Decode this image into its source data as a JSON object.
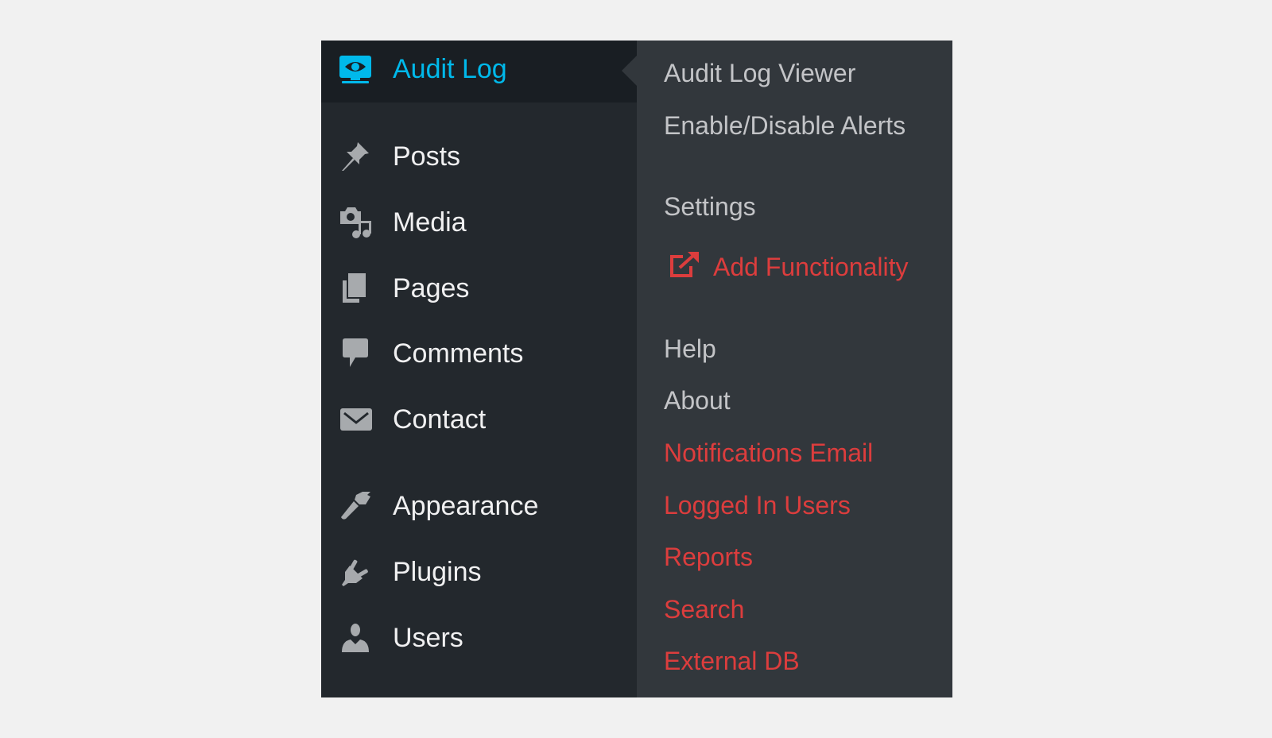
{
  "menu": {
    "header": {
      "label": "Audit Log",
      "icon": "eye-monitor-icon",
      "color": "#00b9eb"
    },
    "items": [
      {
        "label": "Posts",
        "icon": "pin-icon"
      },
      {
        "label": "Media",
        "icon": "media-icon"
      },
      {
        "label": "Pages",
        "icon": "pages-icon"
      },
      {
        "label": "Comments",
        "icon": "comment-icon"
      },
      {
        "label": "Contact",
        "icon": "envelope-icon"
      },
      {
        "label": "Appearance",
        "icon": "paintbrush-icon"
      },
      {
        "label": "Plugins",
        "icon": "plug-icon"
      },
      {
        "label": "Users",
        "icon": "user-icon"
      }
    ]
  },
  "submenu": {
    "items": [
      {
        "label": "Audit Log Viewer",
        "color": "#c3c4c7"
      },
      {
        "label": "Enable/Disable Alerts",
        "color": "#c3c4c7"
      },
      {
        "label": "Settings",
        "color": "#c3c4c7"
      },
      {
        "label": "Add Functionality",
        "color": "#dc3d3d",
        "icon": "external-link-icon"
      },
      {
        "label": "Help",
        "color": "#c3c4c7"
      },
      {
        "label": "About",
        "color": "#c3c4c7"
      },
      {
        "label": "Notifications Email",
        "color": "#dc3d3d"
      },
      {
        "label": "Logged In Users",
        "color": "#dc3d3d"
      },
      {
        "label": "Reports",
        "color": "#dc3d3d"
      },
      {
        "label": "Search",
        "color": "#dc3d3d"
      },
      {
        "label": "External DB",
        "color": "#dc3d3d"
      }
    ]
  }
}
